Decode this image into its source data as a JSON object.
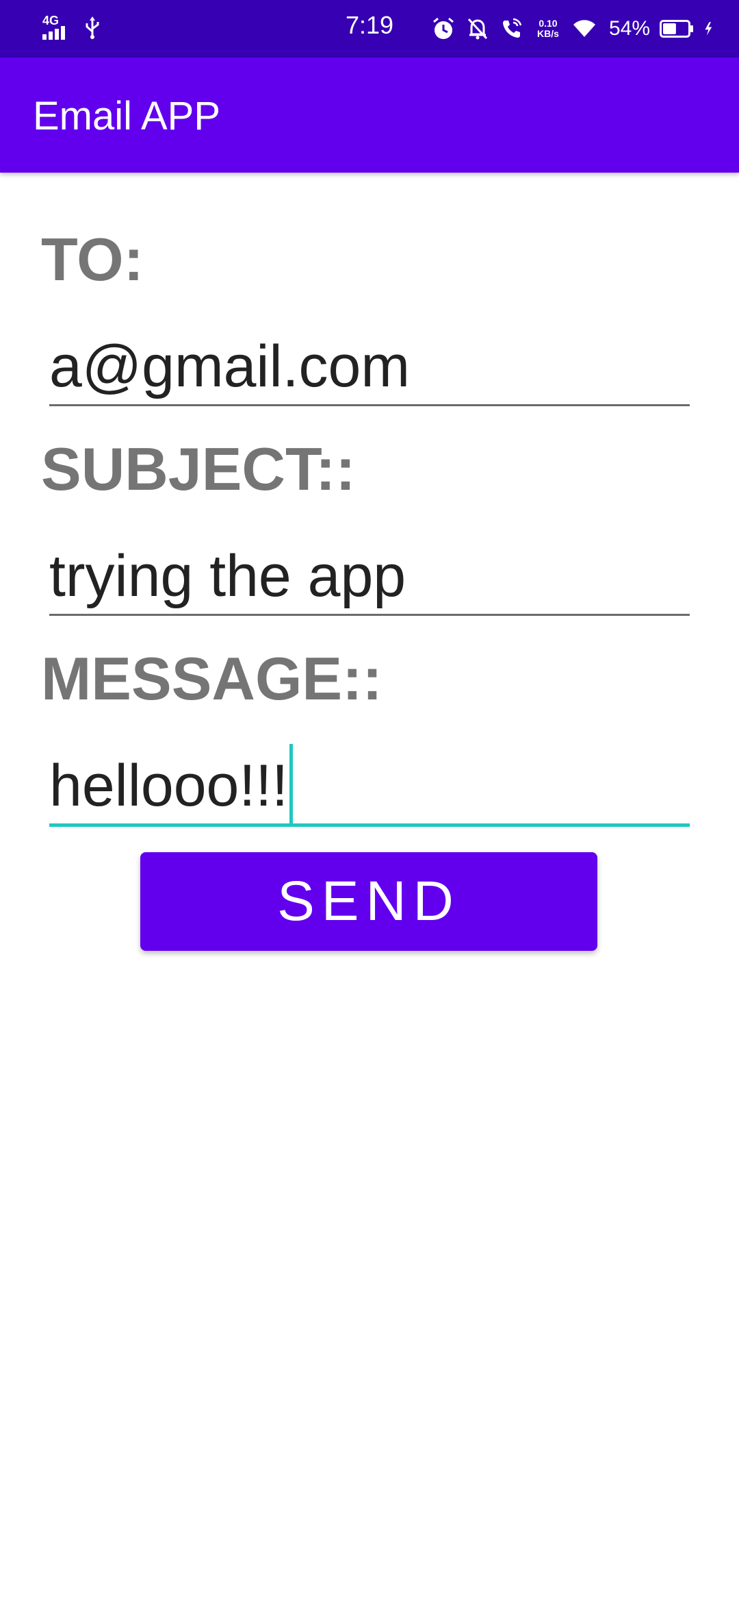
{
  "status_bar": {
    "network": "4G",
    "time": "7:19",
    "speed_value": "0.10",
    "speed_unit": "KB/s",
    "battery_percent": "54%",
    "battery_level": 0.54,
    "icons": [
      "signal-icon",
      "usb-icon",
      "alarm-icon",
      "bell-off-icon",
      "wifi-call-icon",
      "wifi-icon",
      "battery-icon",
      "charging-icon"
    ]
  },
  "app_bar": {
    "title": "Email APP"
  },
  "form": {
    "to_label": "TO:",
    "to_value": "a@gmail.com",
    "subject_label": "SUBJECT::",
    "subject_value": "trying the app",
    "message_label": "MESSAGE::",
    "message_value": "hellooo!!!",
    "send_label": "SEND"
  },
  "colors": {
    "status_bar": "#3700b3",
    "app_bar": "#6200ee",
    "accent": "#1ec8c0",
    "label": "#757575"
  }
}
